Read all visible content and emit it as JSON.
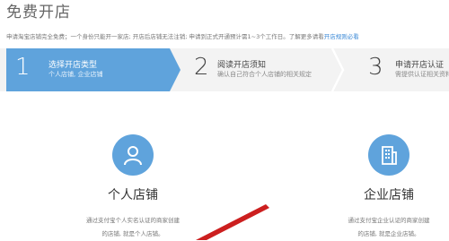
{
  "page": {
    "title": "免费开店"
  },
  "notice": {
    "text": "申请淘宝店铺完全免费；一个身份只能开一家店; 开店后店铺无法注销; 申请到正式开通预计需1~3个工作日。了解更多请看",
    "link": "开店规则必看"
  },
  "steps": [
    {
      "num": "1",
      "title": "选择开店类型",
      "desc": "个人店铺, 企业店铺",
      "state": "active"
    },
    {
      "num": "2",
      "title": "阅读开店须知",
      "desc": "确认自己符合个人店铺的相关规定",
      "state": "pending"
    },
    {
      "num": "3",
      "title": "申请开店认证",
      "desc": "需提供认证相关资料",
      "state": "pending"
    }
  ],
  "cards": {
    "personal": {
      "icon": "person-icon",
      "title": "个人店铺",
      "desc_line1": "通过支付宝个人实名认证的商家创建",
      "desc_line2": "的店铺, 就是个人店铺。"
    },
    "enterprise": {
      "icon": "building-icon",
      "title": "企业店铺",
      "desc_line1": "通过支付宝企业认证的商家创建",
      "desc_line2": "的店铺, 就是企业店铺。"
    }
  },
  "colors": {
    "accent": "#5fa3dc",
    "link": "#3a88d6",
    "annotation": "#cc1f1f"
  }
}
